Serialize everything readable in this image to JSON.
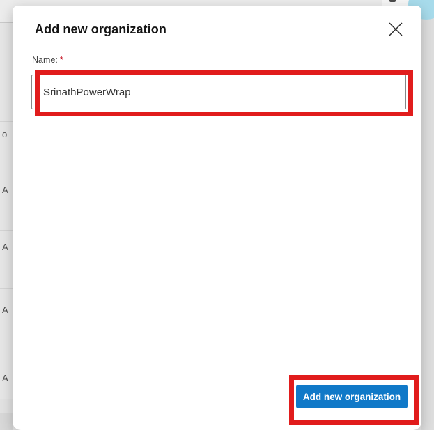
{
  "modal": {
    "title": "Add new organization",
    "name_label": "Name:",
    "required_marker": "*",
    "name_input": {
      "value": "SrinathPowerWrap",
      "placeholder": ""
    },
    "submit_label": "Add new organization"
  },
  "background": {
    "left_column_letters": [
      "o",
      "A",
      "A",
      "A",
      "A"
    ]
  },
  "icons": {
    "close": "x-cross",
    "top_right_blob": "avatar-fragment"
  },
  "colors": {
    "primary_button": "#1079c8",
    "annotation_highlight": "#e11c1c",
    "blob_light_blue": "#a7dbeb",
    "required_red": "#c50f1f"
  }
}
